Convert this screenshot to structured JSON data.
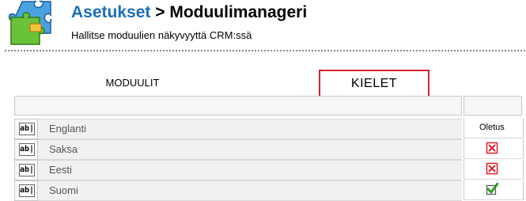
{
  "header": {
    "breadcrumb_link": "Asetukset",
    "separator": " > ",
    "page_title": "Moduulimanageri",
    "subtitle": "Hallitse moduulien näkyvyyttä CRM:ssä"
  },
  "tabs": {
    "modules": "MODUULIT",
    "languages": "KIELET"
  },
  "table": {
    "default_column_label": "Oletus",
    "row_icon_text": "ab|",
    "rows": [
      {
        "name": "Englanti",
        "status": "none"
      },
      {
        "name": "Saksa",
        "status": "disabled"
      },
      {
        "name": "Eesti",
        "status": "disabled"
      },
      {
        "name": "Suomi",
        "status": "enabled"
      }
    ]
  },
  "colors": {
    "link_blue": "#1b6fb8",
    "tab_highlight_red": "#d9232a",
    "disabled_red": "#e0202a",
    "enabled_green": "#2d9a2d"
  },
  "icons": {
    "header": "puzzle-icon",
    "row": "edit-text-icon",
    "disabled": "cross-checkbox-icon",
    "enabled": "check-checkbox-icon"
  }
}
